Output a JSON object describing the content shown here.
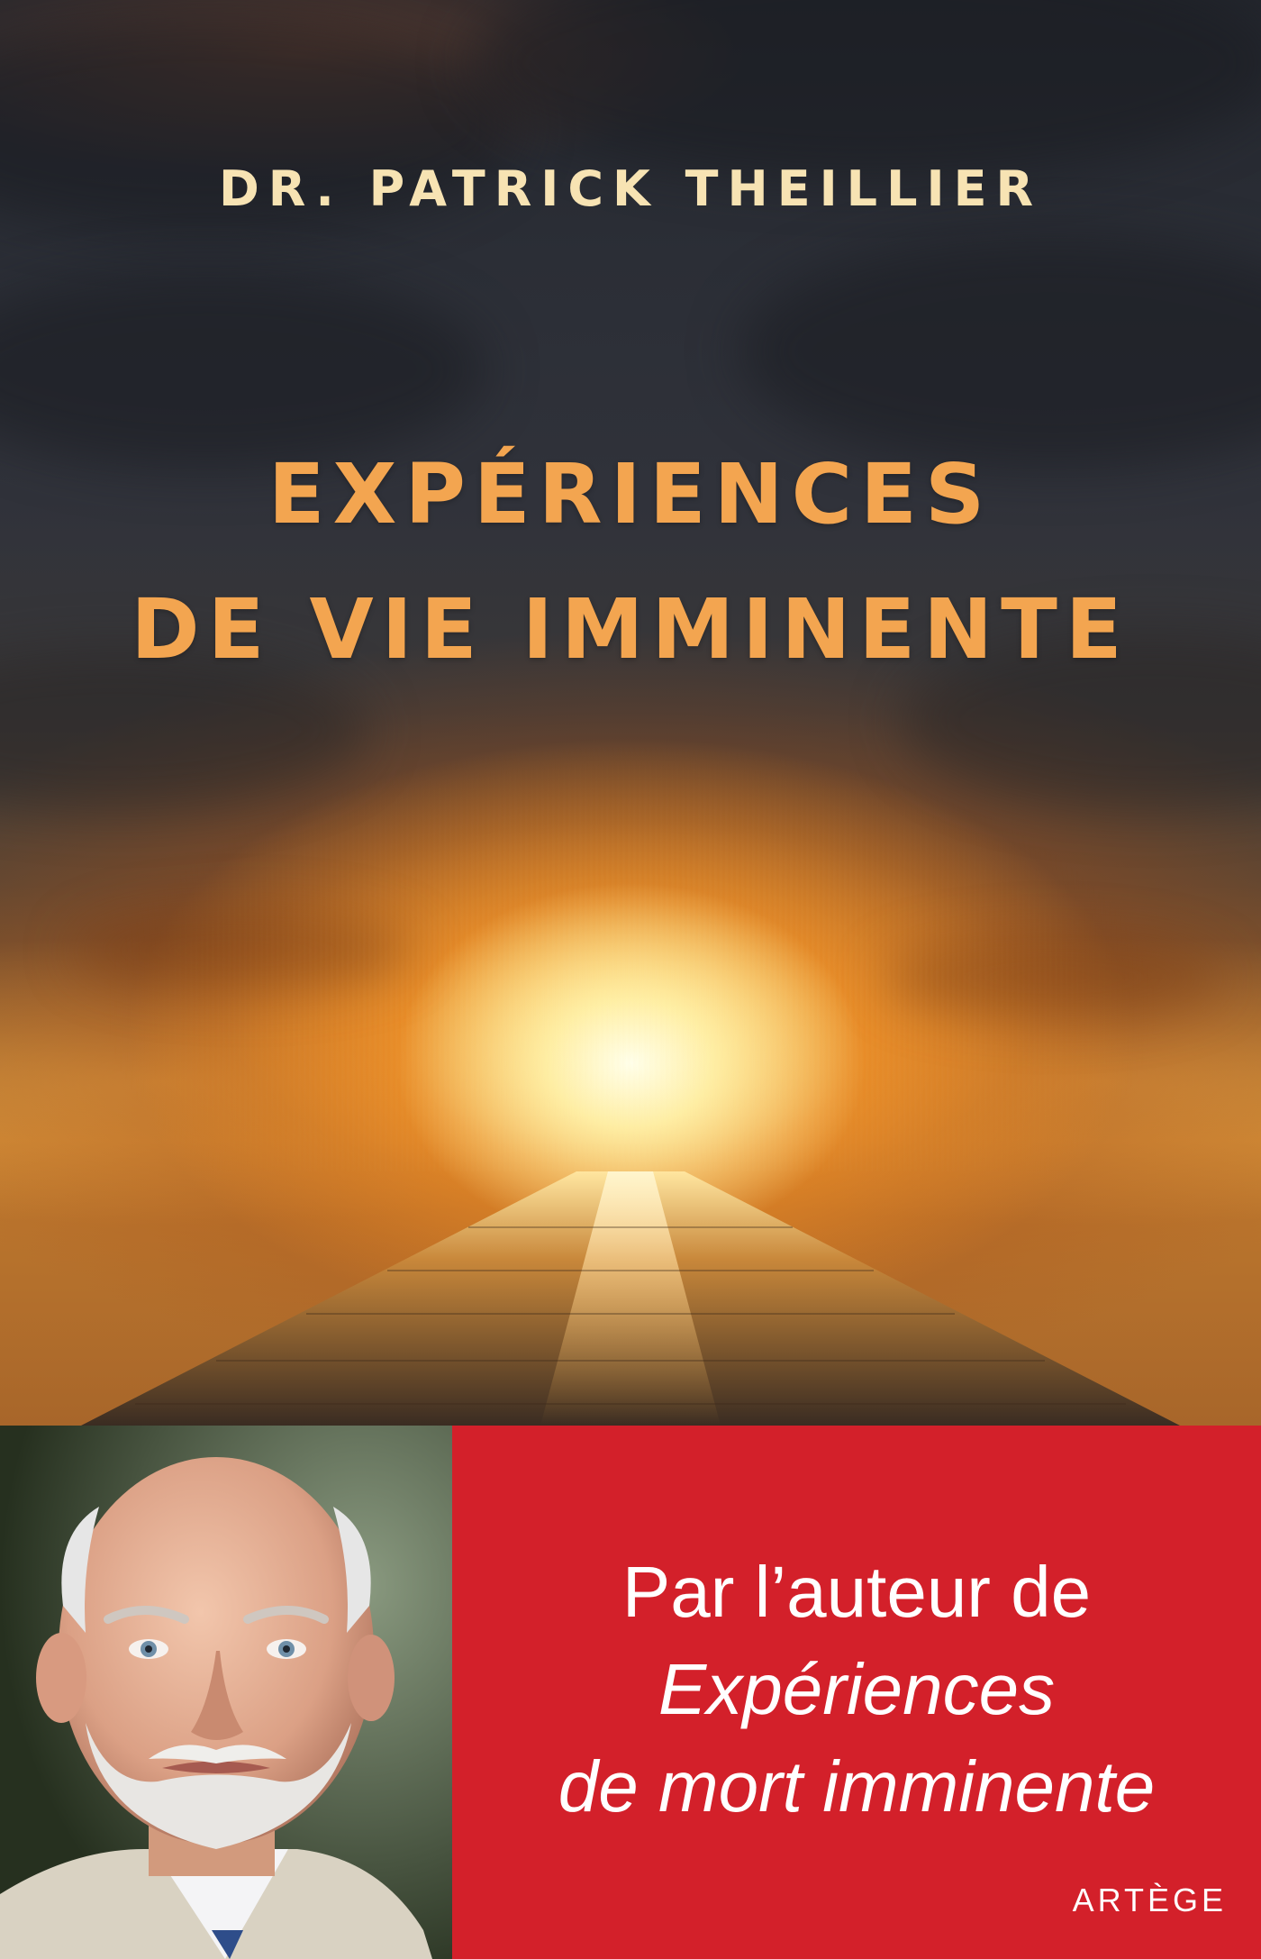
{
  "cover": {
    "author": "DR. PATRICK THEILLIER",
    "title_line1": "EXPÉRIENCES",
    "title_line2": "DE VIE IMMINENTE",
    "tagline_line1": "Par l’auteur de",
    "tagline_line2": "Expériences",
    "tagline_line3": "de mort imminente",
    "publisher": "ARTÈGE"
  },
  "colors": {
    "author_text": "#f7e3b3",
    "title_text": "#f3a550",
    "band_red": "#d3202a",
    "band_text": "#ffffff"
  }
}
